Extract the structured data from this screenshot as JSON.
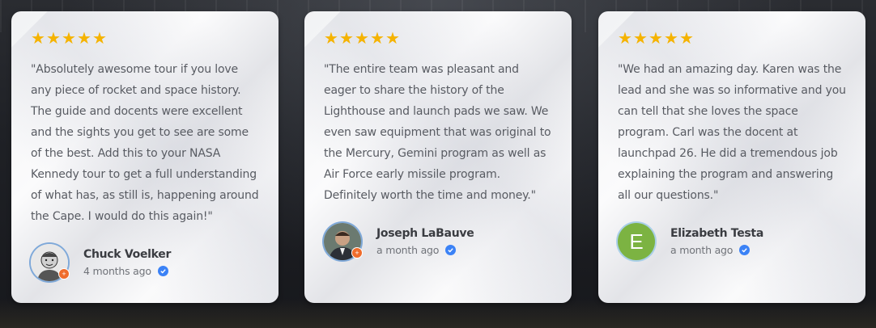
{
  "colors": {
    "star": "#f5b301",
    "verified": "#3b82f6",
    "avatar_letter_bg": "#7cb342",
    "badge": "#ef6c2c"
  },
  "reviews": [
    {
      "rating": 5,
      "text": "\"Absolutely awesome tour if you love any piece of rocket and space history. The guide and docents were excellent and the sights you get to see are some of the best. Add this to your NASA Kennedy tour to get a full understanding of what has, as still is, happening around the Cape. I would do this again!\"",
      "name": "Chuck Voelker",
      "time": "4 months ago",
      "avatar": "photo"
    },
    {
      "rating": 5,
      "text": "\"The entire team was pleasant and eager to share the history of the Lighthouse and launch pads we saw. We even saw equipment that was original to the Mercury, Gemini program as well as Air Force early missile program. Definitely worth the time and money.\"",
      "name": "Joseph LaBauve",
      "time": "a month ago",
      "avatar": "photo"
    },
    {
      "rating": 5,
      "text": "\"We had an amazing day. Karen was the lead and she was so informative and you can tell that she loves the space program. Carl was the docent at launchpad 26. He did a tremendous job explaining the program and answering all our questions.\"",
      "name": "Elizabeth Testa",
      "time": "a month ago",
      "avatar": "letter",
      "avatar_letter": "E"
    }
  ]
}
